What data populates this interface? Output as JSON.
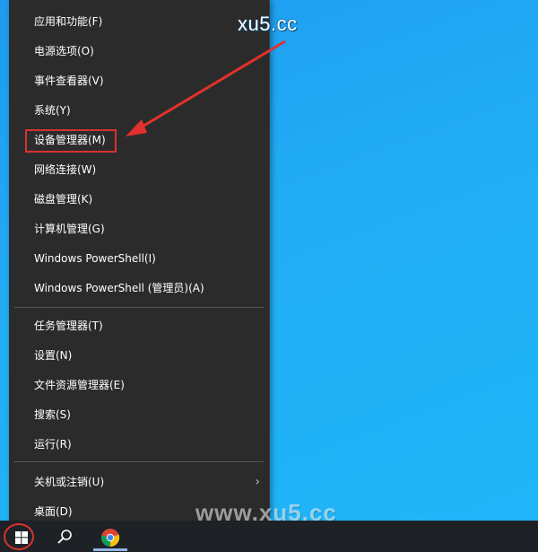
{
  "menu": {
    "groups": [
      [
        {
          "label": "应用和功能(F)",
          "name": "menu-item-apps-and-features"
        },
        {
          "label": "电源选项(O)",
          "name": "menu-item-power-options"
        },
        {
          "label": "事件查看器(V)",
          "name": "menu-item-event-viewer"
        },
        {
          "label": "系统(Y)",
          "name": "menu-item-system"
        },
        {
          "label": "设备管理器(M)",
          "name": "menu-item-device-manager"
        },
        {
          "label": "网络连接(W)",
          "name": "menu-item-network-connections"
        },
        {
          "label": "磁盘管理(K)",
          "name": "menu-item-disk-management"
        },
        {
          "label": "计算机管理(G)",
          "name": "menu-item-computer-management"
        },
        {
          "label": "Windows PowerShell(I)",
          "name": "menu-item-powershell"
        },
        {
          "label": "Windows PowerShell (管理员)(A)",
          "name": "menu-item-powershell-admin"
        }
      ],
      [
        {
          "label": "任务管理器(T)",
          "name": "menu-item-task-manager"
        },
        {
          "label": "设置(N)",
          "name": "menu-item-settings"
        },
        {
          "label": "文件资源管理器(E)",
          "name": "menu-item-file-explorer"
        },
        {
          "label": "搜索(S)",
          "name": "menu-item-search"
        },
        {
          "label": "运行(R)",
          "name": "menu-item-run"
        }
      ],
      [
        {
          "label": "关机或注销(U)",
          "name": "menu-item-shutdown-or-sign-out",
          "submenu": true
        },
        {
          "label": "桌面(D)",
          "name": "menu-item-desktop"
        }
      ]
    ],
    "highlighted": "设备管理器(M)"
  },
  "watermark": {
    "top": "xu5.cc",
    "bottom": "www.xu5.cc"
  },
  "taskbar": {
    "icons": [
      "windows-start-icon",
      "search-icon",
      "chrome-icon"
    ]
  },
  "colors": {
    "menu_bg": "#2b2b2b",
    "desktop": "#1fa7f2",
    "highlight": "#d9312f",
    "taskbar": "#1e2125"
  }
}
